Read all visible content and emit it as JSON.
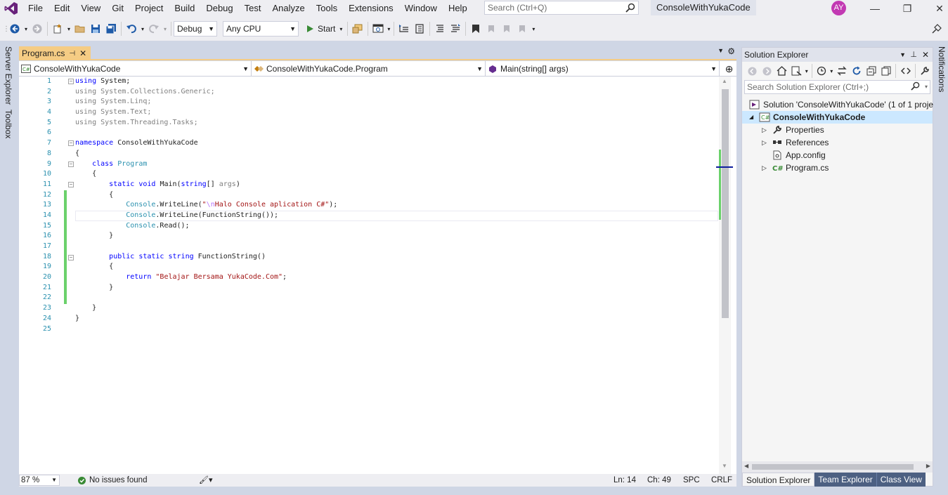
{
  "menubar": {
    "items": [
      "File",
      "Edit",
      "View",
      "Git",
      "Project",
      "Build",
      "Debug",
      "Test",
      "Analyze",
      "Tools",
      "Extensions",
      "Window",
      "Help"
    ],
    "search_placeholder": "Search (Ctrl+Q)",
    "solution_name": "ConsoleWithYukaCode",
    "avatar_initials": "AY"
  },
  "toolbar": {
    "config": "Debug",
    "platform": "Any CPU",
    "start_label": "Start"
  },
  "left_strip": {
    "server_explorer": "Server Explorer",
    "toolbox": "Toolbox"
  },
  "right_strip": {
    "notifications": "Notifications"
  },
  "editor": {
    "tab_label": "Program.cs",
    "nav": {
      "project": "ConsoleWithYukaCode",
      "type": "ConsoleWithYukaCode.Program",
      "member": "Main(string[] args)"
    },
    "line_numbers": [
      "1",
      "2",
      "3",
      "4",
      "5",
      "6",
      "7",
      "8",
      "9",
      "10",
      "11",
      "12",
      "13",
      "14",
      "15",
      "16",
      "17",
      "18",
      "19",
      "20",
      "21",
      "22",
      "23",
      "24",
      "25"
    ],
    "lines": [
      "using System;",
      "using System.Collections.Generic;",
      "using System.Linq;",
      "using System.Text;",
      "using System.Threading.Tasks;",
      "",
      "namespace ConsoleWithYukaCode",
      "{",
      "    class Program",
      "    {",
      "        static void Main(string[] args)",
      "        {",
      "            Console.WriteLine(\"\\nHalo Console aplication C#\");",
      "            Console.WriteLine(FunctionString());",
      "            Console.Read();",
      "        }",
      "",
      "        public static string FunctionString()",
      "        {",
      "            return \"Belajar Bersama YukaCode.Com\";",
      "        }",
      "",
      "    }",
      "}",
      ""
    ],
    "status": {
      "zoom": "87 %",
      "issues": "No issues found",
      "line": "Ln: 14",
      "col": "Ch: 49",
      "whitespace": "SPC",
      "line_ending": "CRLF"
    }
  },
  "solution_explorer": {
    "title": "Solution Explorer",
    "search_placeholder": "Search Solution Explorer (Ctrl+;)",
    "solution_label": "Solution 'ConsoleWithYukaCode' (1 of 1 proje",
    "project_label": "ConsoleWithYukaCode",
    "items": [
      "Properties",
      "References",
      "App.config",
      "Program.cs"
    ],
    "tabs": [
      "Solution Explorer",
      "Team Explorer",
      "Class View"
    ]
  },
  "colors": {
    "accent_tab": "#f5cc84",
    "keyword": "#0000ff",
    "type": "#2b91af",
    "string": "#a31515",
    "change_bar": "#6bd16b",
    "vs_purple": "#68217a"
  }
}
